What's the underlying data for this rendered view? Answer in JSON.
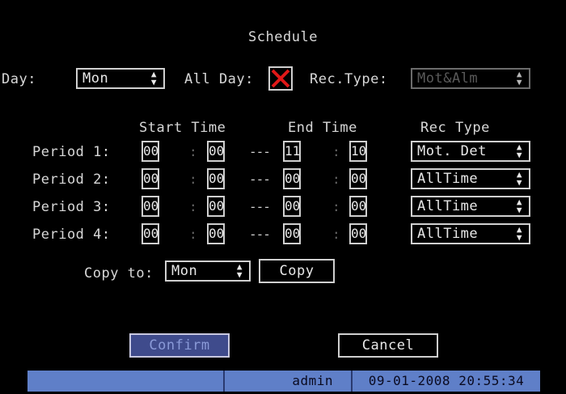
{
  "title": "Schedule",
  "day": {
    "label": "Day:",
    "value": "Mon"
  },
  "all_day": {
    "label": "All Day:",
    "checked": true
  },
  "rec_type_top": {
    "label": "Rec.Type:",
    "value": "Mot&Alm"
  },
  "headers": {
    "start": "Start Time",
    "end": "End Time",
    "rec": "Rec Type"
  },
  "separators": {
    "colon": ":",
    "dash": "---"
  },
  "periods": [
    {
      "label": "Period 1:",
      "start_h": "00",
      "start_m": "00",
      "end_h": "11",
      "end_m": "10",
      "rec": "Mot. Det"
    },
    {
      "label": "Period 2:",
      "start_h": "00",
      "start_m": "00",
      "end_h": "00",
      "end_m": "00",
      "rec": "AllTime"
    },
    {
      "label": "Period 3:",
      "start_h": "00",
      "start_m": "00",
      "end_h": "00",
      "end_m": "00",
      "rec": "AllTime"
    },
    {
      "label": "Period 4:",
      "start_h": "00",
      "start_m": "00",
      "end_h": "00",
      "end_m": "00",
      "rec": "AllTime"
    }
  ],
  "copy": {
    "label": "Copy to:",
    "value": "Mon",
    "button": "Copy"
  },
  "buttons": {
    "confirm": "Confirm",
    "cancel": "Cancel"
  },
  "status": {
    "user": "admin",
    "datetime": "09-01-2008 20:55:34"
  },
  "icons": {
    "select_arrow": "up-down-arrow-icon",
    "checked_mark": "red-x-icon"
  },
  "colors": {
    "check_red": "#e01818",
    "status_blue": "#5f7fc8",
    "confirm_blue": "#3f4b8c"
  }
}
